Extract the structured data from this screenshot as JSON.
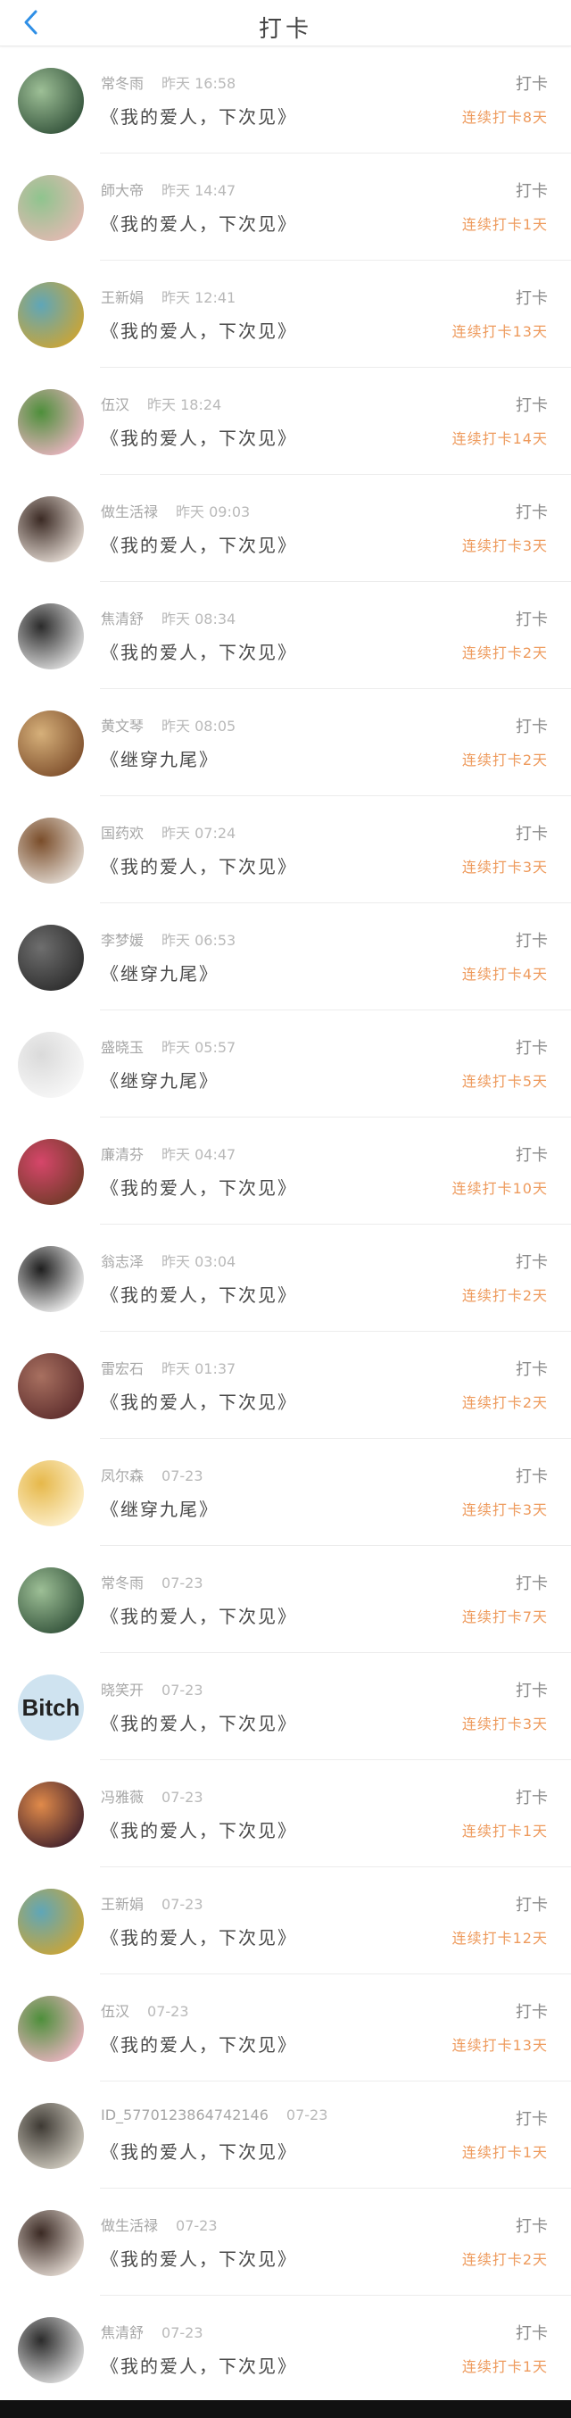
{
  "header": {
    "title": "打卡"
  },
  "colors": {
    "accent": "#2f8fe6",
    "streak": "#ee9a5c"
  },
  "rows": [
    {
      "name": "常冬雨",
      "time": "昨天 16:58",
      "book": "《我的爱人，下次见》",
      "action": "打卡",
      "streak": "连续打卡8天",
      "avatar": {
        "kind": "image",
        "c1": "#2e4d36",
        "c2": "#9dbf96"
      }
    },
    {
      "name": "師大帝",
      "time": "昨天 14:47",
      "book": "《我的爱人，下次见》",
      "action": "打卡",
      "streak": "连续打卡1天",
      "avatar": {
        "kind": "image",
        "c1": "#e7b9b4",
        "c2": "#8fc48e"
      }
    },
    {
      "name": "王新娟",
      "time": "昨天 12:41",
      "book": "《我的爱人，下次见》",
      "action": "打卡",
      "streak": "连续打卡13天",
      "avatar": {
        "kind": "image",
        "c1": "#d1a52e",
        "c2": "#5fa6b8"
      }
    },
    {
      "name": "伍汉",
      "time": "昨天 18:24",
      "book": "《我的爱人，下次见》",
      "action": "打卡",
      "streak": "连续打卡14天",
      "avatar": {
        "kind": "image",
        "c1": "#f2b6c8",
        "c2": "#4e8f3b"
      }
    },
    {
      "name": "做生活禄",
      "time": "昨天 09:03",
      "book": "《我的爱人，下次见》",
      "action": "打卡",
      "streak": "连续打卡3天",
      "avatar": {
        "kind": "image",
        "c1": "#efe6de",
        "c2": "#3b2a24"
      }
    },
    {
      "name": "焦清舒",
      "time": "昨天 08:34",
      "book": "《我的爱人，下次见》",
      "action": "打卡",
      "streak": "连续打卡2天",
      "avatar": {
        "kind": "image",
        "c1": "#eaeaea",
        "c2": "#2b2b2b"
      }
    },
    {
      "name": "黄文琴",
      "time": "昨天 08:05",
      "book": "《继穿九尾》",
      "action": "打卡",
      "streak": "连续打卡2天",
      "avatar": {
        "kind": "image",
        "c1": "#7a4a28",
        "c2": "#d6b07a"
      }
    },
    {
      "name": "国药欢",
      "time": "昨天 07:24",
      "book": "《我的爱人，下次见》",
      "action": "打卡",
      "streak": "连续打卡3天",
      "avatar": {
        "kind": "image",
        "c1": "#e9e3dc",
        "c2": "#7a4d2a"
      }
    },
    {
      "name": "李梦媛",
      "time": "昨天 06:53",
      "book": "《继穿九尾》",
      "action": "打卡",
      "streak": "连续打卡4天",
      "avatar": {
        "kind": "image",
        "c1": "#2a2a2a",
        "c2": "#6e6e6e"
      }
    },
    {
      "name": "盛晓玉",
      "time": "昨天 05:57",
      "book": "《继穿九尾》",
      "action": "打卡",
      "streak": "连续打卡5天",
      "avatar": {
        "kind": "image",
        "c1": "#fafafa",
        "c2": "#dadada"
      }
    },
    {
      "name": "廉清芬",
      "time": "昨天 04:47",
      "book": "《我的爱人，下次见》",
      "action": "打卡",
      "streak": "连续打卡10天",
      "avatar": {
        "kind": "image",
        "c1": "#6b3a25",
        "c2": "#d6466a"
      }
    },
    {
      "name": "翁志泽",
      "time": "昨天 03:04",
      "book": "《我的爱人，下次见》",
      "action": "打卡",
      "streak": "连续打卡2天",
      "avatar": {
        "kind": "image",
        "c1": "#ffffff",
        "c2": "#1e1e1e"
      }
    },
    {
      "name": "雷宏石",
      "time": "昨天 01:37",
      "book": "《我的爱人，下次见》",
      "action": "打卡",
      "streak": "连续打卡2天",
      "avatar": {
        "kind": "image",
        "c1": "#5a2a2a",
        "c2": "#a87060"
      }
    },
    {
      "name": "凤尔森",
      "time": "07-23",
      "book": "《继穿九尾》",
      "action": "打卡",
      "streak": "连续打卡3天",
      "avatar": {
        "kind": "image",
        "c1": "#fff4d6",
        "c2": "#e6b84a"
      }
    },
    {
      "name": "常冬雨",
      "time": "07-23",
      "book": "《我的爱人，下次见》",
      "action": "打卡",
      "streak": "连续打卡7天",
      "avatar": {
        "kind": "image",
        "c1": "#2e4d36",
        "c2": "#9dbf96"
      }
    },
    {
      "name": "晓笑开",
      "time": "07-23",
      "book": "《我的爱人，下次见》",
      "action": "打卡",
      "streak": "连续打卡3天",
      "avatar": {
        "kind": "text",
        "text": "Bitch",
        "c1": "#cfe3f0",
        "c2": "#cfe3f0"
      }
    },
    {
      "name": "冯雅薇",
      "time": "07-23",
      "book": "《我的爱人，下次见》",
      "action": "打卡",
      "streak": "连续打卡1天",
      "avatar": {
        "kind": "image",
        "c1": "#3a1c2a",
        "c2": "#e08a4a"
      }
    },
    {
      "name": "王新娟",
      "time": "07-23",
      "book": "《我的爱人，下次见》",
      "action": "打卡",
      "streak": "连续打卡12天",
      "avatar": {
        "kind": "image",
        "c1": "#d1a52e",
        "c2": "#5fa6b8"
      }
    },
    {
      "name": "伍汉",
      "time": "07-23",
      "book": "《我的爱人，下次见》",
      "action": "打卡",
      "streak": "连续打卡13天",
      "avatar": {
        "kind": "image",
        "c1": "#f2b6c8",
        "c2": "#4e8f3b"
      }
    },
    {
      "name": "ID_5770123864742146",
      "time": "07-23",
      "book": "《我的爱人，下次见》",
      "action": "打卡",
      "streak": "连续打卡1天",
      "avatar": {
        "kind": "image",
        "c1": "#d9d4c8",
        "c2": "#3e3a34"
      }
    },
    {
      "name": "做生活禄",
      "time": "07-23",
      "book": "《我的爱人，下次见》",
      "action": "打卡",
      "streak": "连续打卡2天",
      "avatar": {
        "kind": "image",
        "c1": "#efe6de",
        "c2": "#3b2a24"
      }
    },
    {
      "name": "焦清舒",
      "time": "07-23",
      "book": "《我的爱人，下次见》",
      "action": "打卡",
      "streak": "连续打卡1天",
      "avatar": {
        "kind": "image",
        "c1": "#eaeaea",
        "c2": "#2b2b2b"
      }
    }
  ]
}
